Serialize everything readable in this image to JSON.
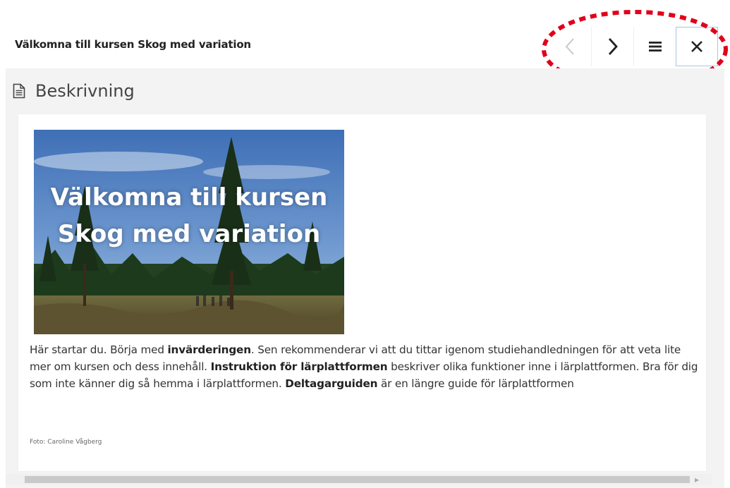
{
  "header": {
    "course_title": "Välkomna till kursen Skog med variation",
    "nav": {
      "prev_icon": "chevron-left-icon",
      "next_icon": "chevron-right-icon",
      "menu_icon": "hamburger-menu-icon",
      "close_icon": "close-icon"
    }
  },
  "section": {
    "title": "Beskrivning",
    "icon": "document-icon"
  },
  "hero": {
    "line1": "Välkomna till kursen",
    "line2": "Skog med variation"
  },
  "description": {
    "p1_a": "Här startar du. Börja med ",
    "p1_b": "invärderingen",
    "p1_c": ". Sen rekommenderar vi att du tittar igenom studiehandledningen för att veta lite mer om kursen och dess innehåll. ",
    "p1_d": "Instruktion för lärplattformen",
    "p1_e": " beskriver olika funktioner inne i lärplattformen. Bra för dig som inte känner dig så hemma i lärplattformen. ",
    "p1_f": "Deltagarguiden",
    "p1_g": " är en längre guide för lärplattformen"
  },
  "photo_credit": "Foto: Caroline Vågberg",
  "colors": {
    "highlight": "#e0001b",
    "close_border": "#a9c4e4"
  }
}
